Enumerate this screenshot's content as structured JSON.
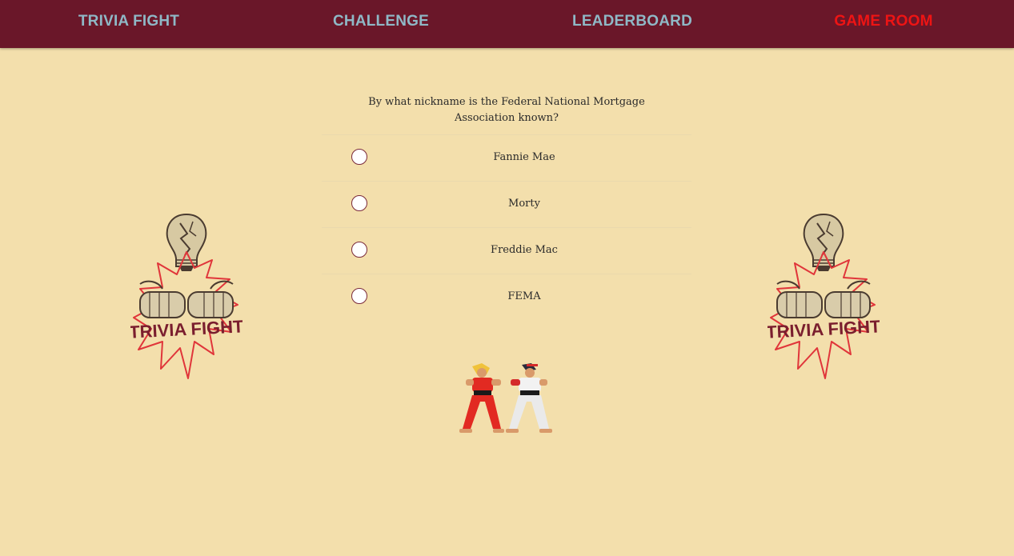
{
  "nav": {
    "items": [
      {
        "label": "TRIVIA FIGHT",
        "active": false
      },
      {
        "label": "CHALLENGE",
        "active": false
      },
      {
        "label": "LEADERBOARD",
        "active": false
      },
      {
        "label": "GAME ROOM",
        "active": true
      }
    ]
  },
  "quiz": {
    "question": "By what nickname is the Federal National Mortgage Association known?",
    "answers": [
      "Fannie Mae",
      "Morty",
      "Freddie Mac",
      "FEMA"
    ]
  },
  "logo": {
    "text": "TRIVIA FIGHT"
  },
  "colors": {
    "background": "#f3dfac",
    "navbar": "#6a1729",
    "nav_text": "#8fb8c6",
    "nav_active": "#ee1414",
    "logo_text": "#7a1e2e",
    "logo_burst": "#e0353a"
  }
}
